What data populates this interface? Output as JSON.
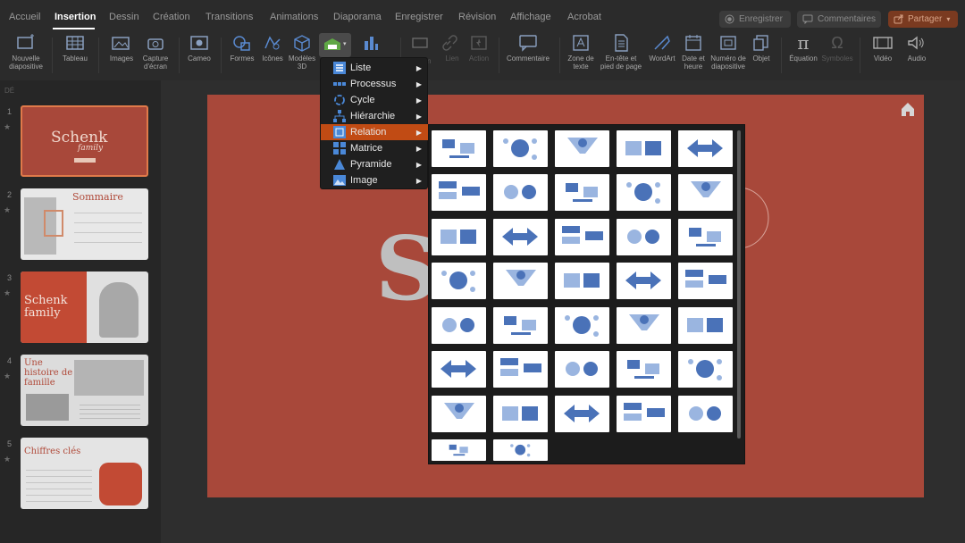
{
  "tabs": [
    "Accueil",
    "Insertion",
    "Dessin",
    "Création",
    "Transitions",
    "Animations",
    "Diaporama",
    "Enregistrer",
    "Révision",
    "Affichage",
    "Acrobat"
  ],
  "active_tab": "Insertion",
  "top_buttons": {
    "record": "Enregistrer",
    "comments": "Commentaires",
    "share": "Partager"
  },
  "ribbon": {
    "new_slide": "Nouvelle diapositive",
    "table": "Tableau",
    "images": "Images",
    "screenshot": "Capture d'écran",
    "cameo": "Cameo",
    "shapes": "Formes",
    "icons": "Icônes",
    "models3d": "Modèles 3D",
    "link_partial": "n",
    "link": "Lien",
    "action": "Action",
    "comment": "Commentaire",
    "textbox": "Zone de texte",
    "header_footer": "En-tête et pied de page",
    "wordart": "WordArt",
    "datetime": "Date et heure",
    "slide_number": "Numéro de diapositive",
    "object": "Objet",
    "equation": "Équation",
    "symbols": "Symboles",
    "video": "Vidéo",
    "audio": "Audio"
  },
  "sidebar": {
    "header": "DÉ",
    "slides": [
      {
        "number": "1",
        "title": "Schenk",
        "subtitle": "family"
      },
      {
        "number": "2",
        "title": "Sommaire"
      },
      {
        "number": "3",
        "title": "Schenk family"
      },
      {
        "number": "4",
        "title": "Une histoire de famille"
      },
      {
        "number": "5",
        "title": "Chiffres clés"
      }
    ]
  },
  "slide": {
    "big_letter": "S"
  },
  "smartart_menu": {
    "items": [
      {
        "label": "Liste",
        "icon": "list-icon"
      },
      {
        "label": "Processus",
        "icon": "process-icon"
      },
      {
        "label": "Cycle",
        "icon": "cycle-icon"
      },
      {
        "label": "Hiérarchie",
        "icon": "hierarchy-icon"
      },
      {
        "label": "Relation",
        "icon": "relationship-icon"
      },
      {
        "label": "Matrice",
        "icon": "matrix-icon"
      },
      {
        "label": "Pyramide",
        "icon": "pyramid-icon"
      },
      {
        "label": "Image",
        "icon": "picture-icon"
      }
    ],
    "selected": "Relation"
  },
  "colors": {
    "accent": "#c14b14",
    "slide_bg": "#a8483a",
    "diagram_blue": "#4a72b8",
    "diagram_light": "#9ab5e0"
  },
  "gallery": {
    "layouts": [
      "balance",
      "funnel-circle",
      "funnel",
      "gears",
      "hexagon-cluster",
      "counterbalance-arrows",
      "plus-minus",
      "circular-arrows",
      "opposing-arrows",
      "arrow-ribbon",
      "converging-arrows",
      "diverging-arrows",
      "up-down-arrows",
      "triangle-pyramid",
      "nested-boxes",
      "half-circle-list",
      "tabbed-table",
      "column-table",
      "segmented-columns",
      "labeled-hierarchy",
      "stacked-bars",
      "equation",
      "horizontal-equation",
      "related-blocks",
      "hierarchy-tree",
      "radial-cluster",
      "radial-cycle",
      "diverging-radial",
      "radial-venn",
      "circular-radial",
      "target",
      "matrix-grid",
      "pie",
      "venn-three",
      "linear-venn",
      "nested-target",
      "arrow-relationship"
    ]
  }
}
